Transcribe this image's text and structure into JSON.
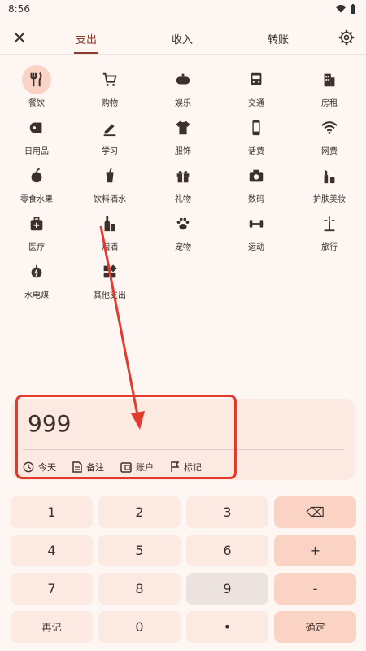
{
  "status_bar": {
    "time": "8:56"
  },
  "header": {
    "tabs": [
      {
        "label": "支出",
        "active": true
      },
      {
        "label": "收入",
        "active": false
      },
      {
        "label": "转账",
        "active": false
      }
    ]
  },
  "categories": [
    {
      "label": "餐饮",
      "icon": "restaurant-icon",
      "selected": true
    },
    {
      "label": "购物",
      "icon": "shopping-cart-icon"
    },
    {
      "label": "娱乐",
      "icon": "gamepad-icon"
    },
    {
      "label": "交通",
      "icon": "bus-icon"
    },
    {
      "label": "房租",
      "icon": "building-icon"
    },
    {
      "label": "日用品",
      "icon": "toilet-paper-icon"
    },
    {
      "label": "学习",
      "icon": "pen-icon"
    },
    {
      "label": "服饰",
      "icon": "tshirt-icon"
    },
    {
      "label": "话费",
      "icon": "phone-icon"
    },
    {
      "label": "网费",
      "icon": "wifi-icon"
    },
    {
      "label": "零食水果",
      "icon": "apple-icon"
    },
    {
      "label": "饮料酒水",
      "icon": "drink-cup-icon"
    },
    {
      "label": "礼物",
      "icon": "gift-icon"
    },
    {
      "label": "数码",
      "icon": "camera-icon"
    },
    {
      "label": "护肤美妆",
      "icon": "lipstick-icon"
    },
    {
      "label": "医疗",
      "icon": "medical-kit-icon"
    },
    {
      "label": "烟酒",
      "icon": "liquor-icon"
    },
    {
      "label": "宠物",
      "icon": "paw-icon"
    },
    {
      "label": "运动",
      "icon": "dumbbell-icon"
    },
    {
      "label": "旅行",
      "icon": "palm-tree-icon"
    },
    {
      "label": "水电煤",
      "icon": "utility-icon"
    },
    {
      "label": "其他支出",
      "icon": "other-grid-icon"
    }
  ],
  "entry": {
    "amount": "999",
    "meta": [
      {
        "label": "今天",
        "icon": "clock-icon"
      },
      {
        "label": "备注",
        "icon": "note-icon"
      },
      {
        "label": "账户",
        "icon": "wallet-icon"
      },
      {
        "label": "标记",
        "icon": "flag-icon"
      }
    ]
  },
  "keypad": {
    "rows": [
      [
        "1",
        "2",
        "3",
        "⌫"
      ],
      [
        "4",
        "5",
        "6",
        "+"
      ],
      [
        "7",
        "8",
        "9",
        "-"
      ],
      [
        "再记",
        "0",
        "•",
        "确定"
      ]
    ]
  },
  "colors": {
    "background": "#fdf6f3",
    "accent": "#8a3a2a",
    "card": "#fbe9e2",
    "selected": "#fbd3c5",
    "annotation": "#e23b2e"
  }
}
